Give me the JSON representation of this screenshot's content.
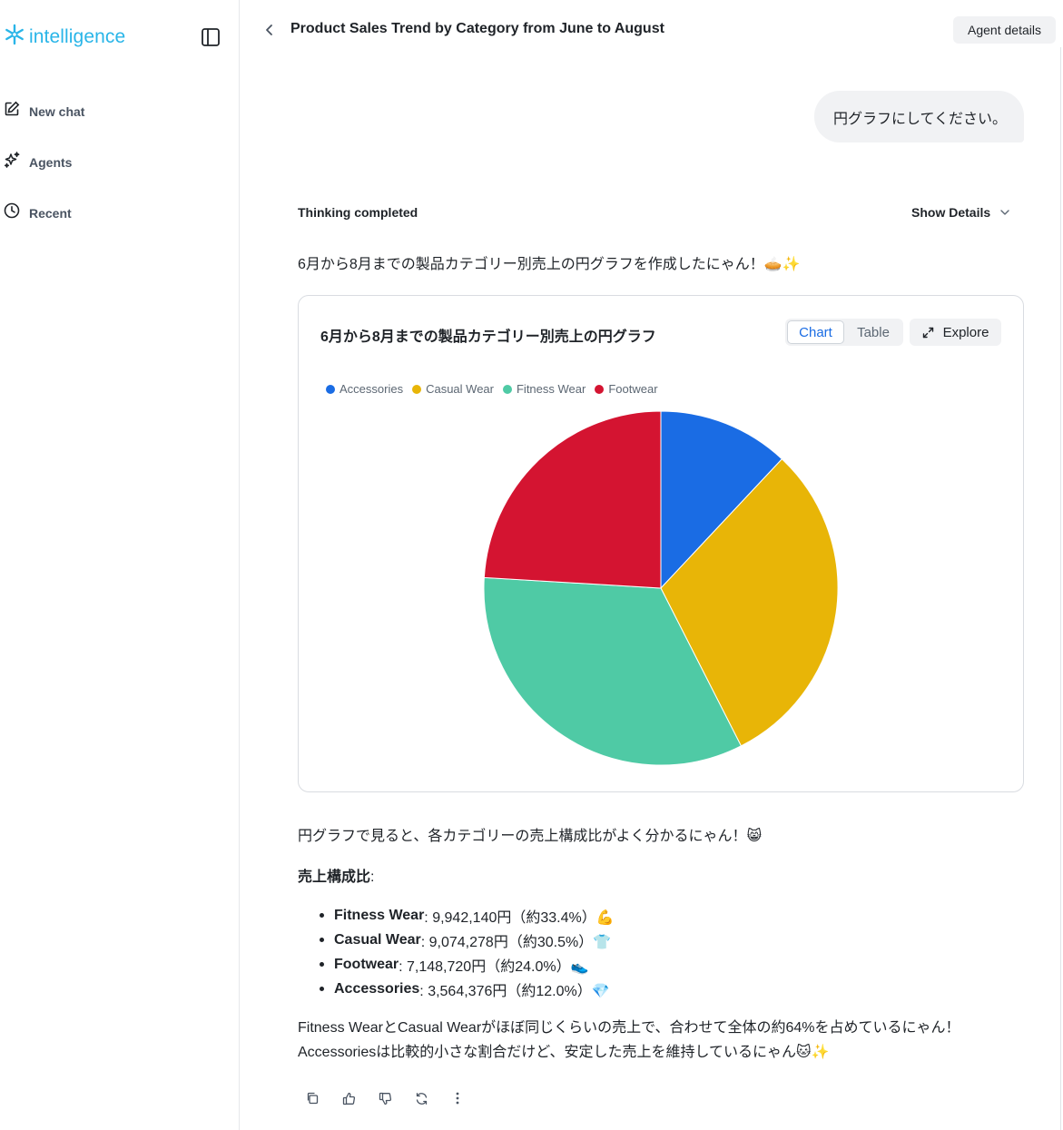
{
  "app": {
    "logo_text": "intelligence"
  },
  "sidebar": {
    "items": [
      {
        "label": "New chat",
        "icon": "edit-icon"
      },
      {
        "label": "Agents",
        "icon": "sparkle-icon"
      },
      {
        "label": "Recent",
        "icon": "clock-icon"
      }
    ]
  },
  "header": {
    "title": "Product Sales Trend by Category from June to August",
    "agent_details": "Agent details"
  },
  "conversation": {
    "user_message": "円グラフにしてください。",
    "thinking_label": "Thinking completed",
    "show_details": "Show Details",
    "intro": "6月から8月までの製品カテゴリー別売上の円グラフを作成したにゃん！🥧✨",
    "chart_card": {
      "title": "6月から8月までの製品カテゴリー別売上の円グラフ",
      "tab_chart": "Chart",
      "tab_table": "Table",
      "explore": "Explore"
    },
    "after_chart": "円グラフで見ると、各カテゴリーの売上構成比がよく分かるにゃん！😸",
    "ratio_heading": "売上構成比",
    "ratio_colon": ":",
    "breakdown": [
      {
        "name": "Fitness Wear",
        "text": ": 9,942,140円（約33.4%）💪"
      },
      {
        "name": "Casual Wear",
        "text": ": 9,074,278円（約30.5%）👕"
      },
      {
        "name": "Footwear",
        "text": ": 7,148,720円（約24.0%）👟"
      },
      {
        "name": "Accessories",
        "text": ": 3,564,376円（約12.0%）💎"
      }
    ],
    "summary_line1": "Fitness WearとCasual Wearがほぼ同じくらいの売上で、合わせて全体の約64%を占めているにゃん！",
    "summary_line2": "Accessoriesは比較的小さな割合だけど、安定した売上を維持しているにゃん🐱✨"
  },
  "chart_data": {
    "type": "pie",
    "categories": [
      "Accessories",
      "Casual Wear",
      "Fitness Wear",
      "Footwear"
    ],
    "values": [
      3564376,
      9074278,
      9942140,
      7148720
    ],
    "colors": [
      "#1a6ce4",
      "#e8b507",
      "#4fcaa5",
      "#d41431"
    ],
    "legend_position": "top-left"
  }
}
